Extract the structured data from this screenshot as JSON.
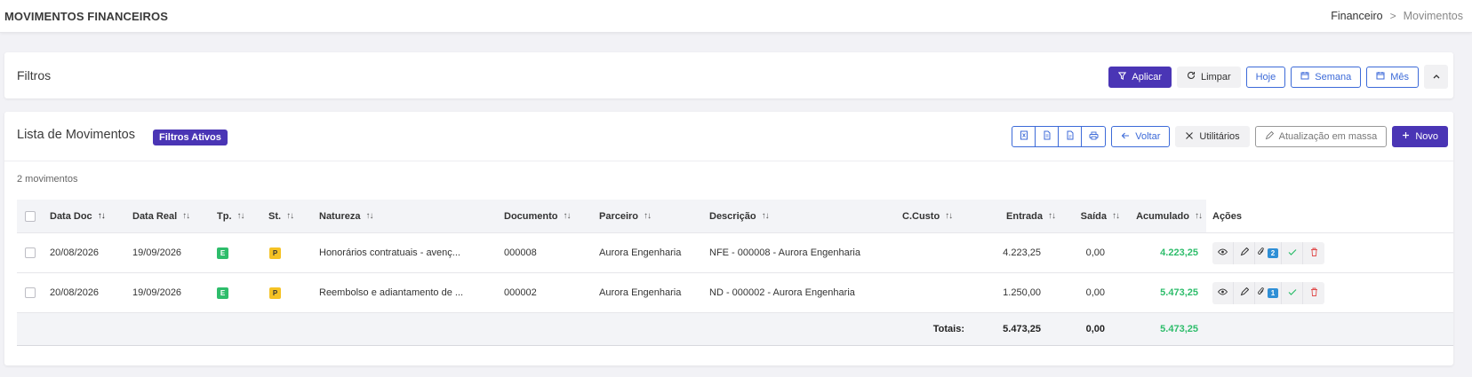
{
  "header": {
    "title": "MOVIMENTOS FINANCEIROS",
    "breadcrumb": [
      "Financeiro",
      "Movimentos"
    ],
    "breadcrumb_separator": ">"
  },
  "filters": {
    "title": "Filtros",
    "buttons": {
      "aplicar": "Aplicar",
      "limpar": "Limpar",
      "hoje": "Hoje",
      "semana": "Semana",
      "mes": "Mês"
    }
  },
  "list": {
    "title": "Lista de Movimentos",
    "active_badge": "Filtros Ativos",
    "count_text": "2 movimentos",
    "buttons": {
      "voltar": "Voltar",
      "utilitarios": "Utilitários",
      "atualizacao": "Atualização em massa",
      "novo": "Novo"
    },
    "columns": {
      "data_doc": "Data Doc",
      "data_real": "Data Real",
      "tp": "Tp.",
      "st": "St.",
      "natureza": "Natureza",
      "documento": "Documento",
      "parceiro": "Parceiro",
      "descricao": "Descrição",
      "ccusto": "C.Custo",
      "entrada": "Entrada",
      "saida": "Saída",
      "acumulado": "Acumulado",
      "acoes": "Ações"
    },
    "rows": [
      {
        "data_doc": "20/08/2026",
        "data_real": "19/09/2026",
        "tp": "E",
        "st": "P",
        "natureza": "Honorários contratuais - avenç...",
        "documento": "000008",
        "parceiro": "Aurora Engenharia",
        "descricao": "NFE - 000008 - Aurora Engenharia",
        "ccusto": "",
        "entrada": "4.223,25",
        "saida": "0,00",
        "acumulado": "4.223,25",
        "attachments": "2"
      },
      {
        "data_doc": "20/08/2026",
        "data_real": "19/09/2026",
        "tp": "E",
        "st": "P",
        "natureza": "Reembolso e adiantamento de ...",
        "documento": "000002",
        "parceiro": "Aurora Engenharia",
        "descricao": "ND - 000002 - Aurora Engenharia",
        "ccusto": "",
        "entrada": "1.250,00",
        "saida": "0,00",
        "acumulado": "5.473,25",
        "attachments": "1"
      }
    ],
    "totals": {
      "label": "Totais:",
      "entrada": "5.473,25",
      "saida": "0,00",
      "acumulado": "5.473,25"
    }
  },
  "colors": {
    "primary": "#4a35b5",
    "outline_blue": "#3c6ad8",
    "positive_green": "#2ebd6b",
    "status_yellow": "#f5c224",
    "danger_red": "#e04a4a",
    "badge_blue": "#2f8fd6"
  },
  "icons": {
    "aplicar": "filter-icon",
    "limpar": "refresh-icon",
    "semana": "calendar-icon",
    "mes": "calendar-icon",
    "collapse": "chevron-up-icon",
    "export": [
      "excel-icon",
      "document-icon",
      "pdf-icon",
      "print-icon"
    ],
    "voltar": "arrow-left-icon",
    "utilitarios": "tools-icon",
    "atualizacao": "pencil-icon",
    "novo": "plus-icon",
    "row_actions": [
      "eye-icon",
      "pencil-icon",
      "paperclip-icon",
      "check-icon",
      "trash-icon"
    ]
  }
}
